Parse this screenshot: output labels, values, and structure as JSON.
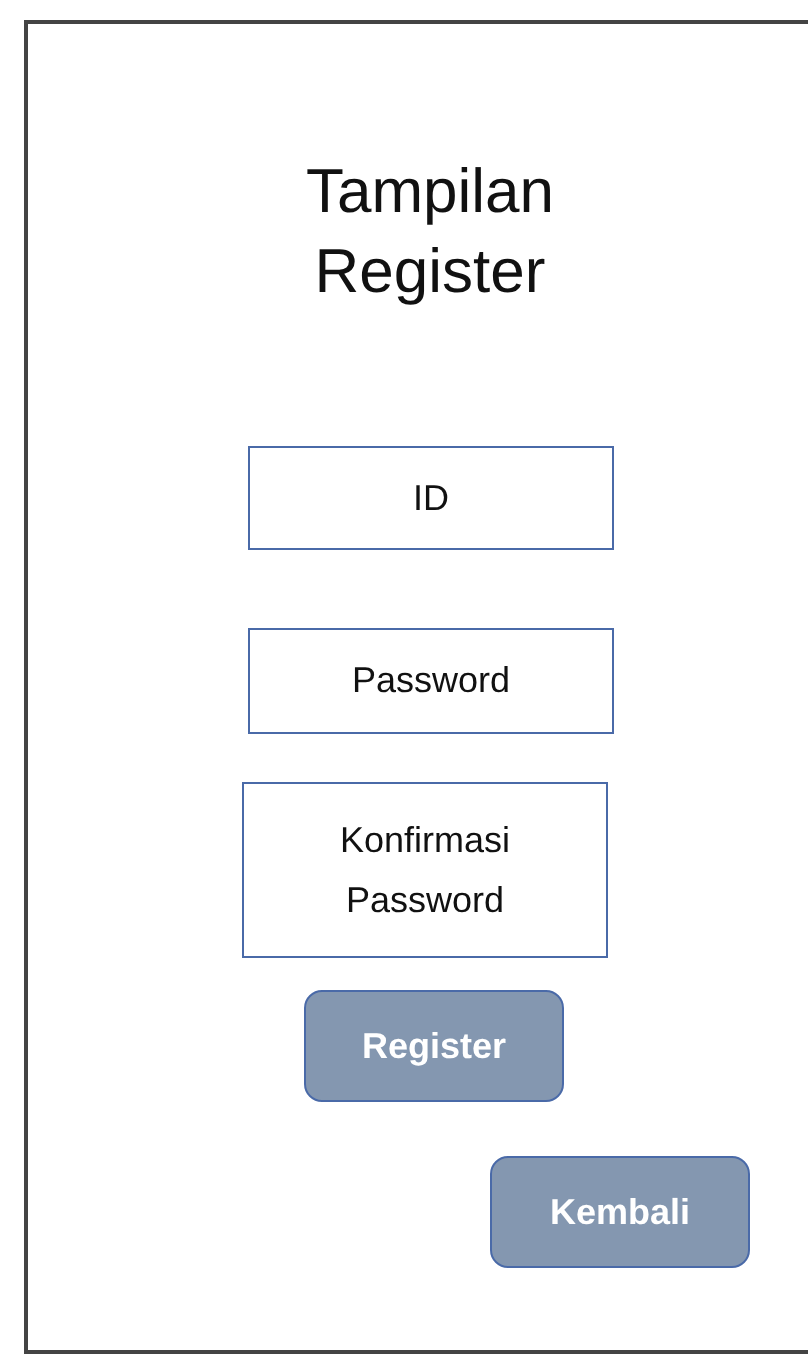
{
  "title": "Tampilan Register",
  "fields": [
    {
      "placeholder": "ID"
    },
    {
      "placeholder": "Password"
    },
    {
      "placeholder": "Konfirmasi Password"
    }
  ],
  "buttons": [
    {
      "label": "Register",
      "kind": "submit"
    },
    {
      "label": "Kembali",
      "kind": "back"
    }
  ]
}
